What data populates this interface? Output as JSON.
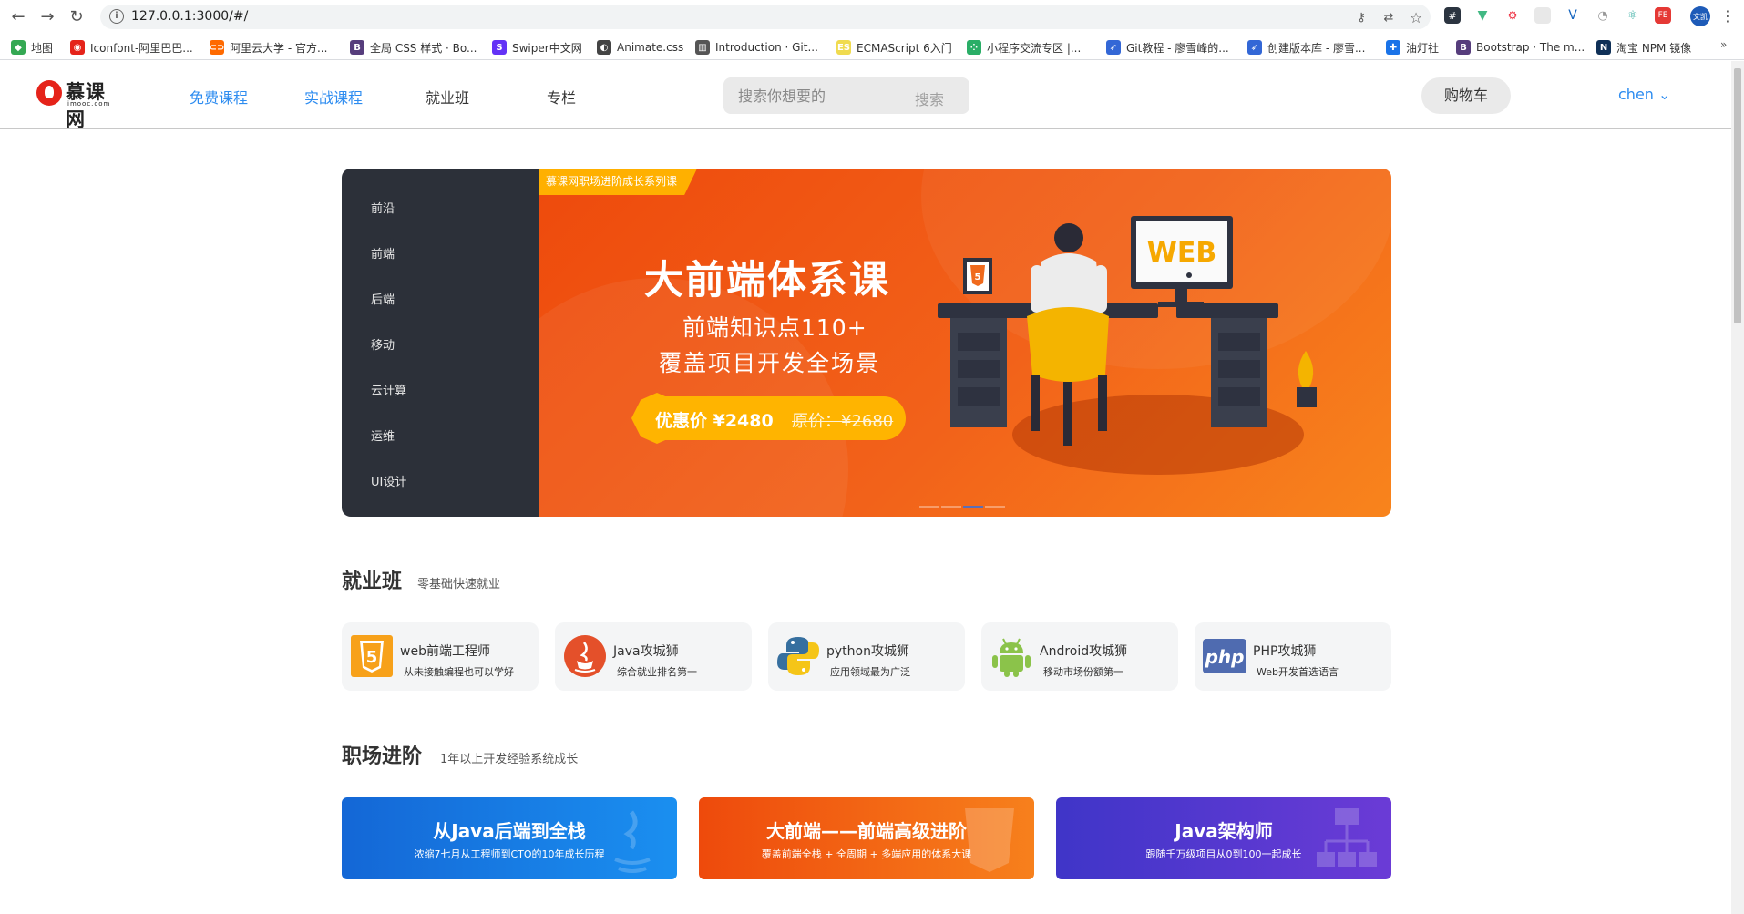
{
  "browser": {
    "url": "127.0.0.1:3000/#/",
    "profile_label": "文凯",
    "bookmarks": [
      {
        "label": "地图",
        "color": "#34a853",
        "glyph": "◆"
      },
      {
        "label": "Iconfont-阿里巴巴...",
        "color": "#e5231a",
        "glyph": "◉"
      },
      {
        "label": "阿里云大学 - 官方...",
        "color": "#ff6a00",
        "glyph": "⊂⊃"
      },
      {
        "label": "全局 CSS 样式 · Bo...",
        "color": "#563d7c",
        "glyph": "B"
      },
      {
        "label": "Swiper中文网",
        "color": "#6332f6",
        "glyph": "S"
      },
      {
        "label": "Animate.css",
        "color": "#444444",
        "glyph": "◐"
      },
      {
        "label": "Introduction · Git...",
        "color": "#555555",
        "glyph": "▥"
      },
      {
        "label": "ECMAScript 6入门",
        "color": "#f0db4f",
        "glyph": "ES"
      },
      {
        "label": "小程序交流专区 |...",
        "color": "#2aae67",
        "glyph": "⁘"
      },
      {
        "label": "Git教程 - 廖雪峰的...",
        "color": "#3367d6",
        "glyph": "➶"
      },
      {
        "label": "创建版本库 - 廖雪...",
        "color": "#3367d6",
        "glyph": "➶"
      },
      {
        "label": "油灯社",
        "color": "#1a73e8",
        "glyph": "✚"
      },
      {
        "label": "Bootstrap · The m...",
        "color": "#563d7c",
        "glyph": "B"
      },
      {
        "label": "淘宝 NPM 镜像",
        "color": "#0f3057",
        "glyph": "N"
      }
    ]
  },
  "header": {
    "logo_text": "慕课网",
    "logo_sub": "imooc.com",
    "nav": [
      "免费课程",
      "实战课程",
      "就业班",
      "专栏"
    ],
    "search_placeholder": "搜索你想要的",
    "search_button": "搜索",
    "cart": "购物车",
    "user": "chen ⌄"
  },
  "banner": {
    "categories": [
      "前沿",
      "前端",
      "后端",
      "移动",
      "云计算",
      "运维",
      "UI设计"
    ],
    "ribbon": "慕课网职场进阶成长系列课",
    "title": "大前端体系课",
    "subtitle_1": "前端知识点110+",
    "subtitle_2": "覆盖项目开发全场景",
    "price_now": "优惠价 ¥2480",
    "price_old": "原价：¥2680",
    "screen_text": "WEB",
    "slide_count": 4,
    "active_slide": 3
  },
  "employment": {
    "title": "就业班",
    "subtitle": "零基础快速就业",
    "cards": [
      {
        "name": "web前端工程师",
        "desc": "从未接触编程也可以学好",
        "icon": "html5-icon"
      },
      {
        "name": "Java攻城狮",
        "desc": "综合就业排名第一",
        "icon": "java-icon"
      },
      {
        "name": "python攻城狮",
        "desc": "应用领域最为广泛",
        "icon": "python-icon"
      },
      {
        "name": "Android攻城狮",
        "desc": "移动市场份额第一",
        "icon": "android-icon"
      },
      {
        "name": "PHP攻城狮",
        "desc": "Web开发首选语言",
        "icon": "php-icon"
      }
    ]
  },
  "advance": {
    "title": "职场进阶",
    "subtitle": "1年以上开发经验系统成长",
    "cards": [
      {
        "title": "从Java后端到全栈",
        "desc": "浓缩7七月从工程师到CTO的10年成长历程",
        "color_from": "#1467d6",
        "color_to": "#1a8ff0"
      },
      {
        "title": "大前端——前端高级进阶",
        "desc": "覆盖前端全栈 + 全周期 + 多端应用的体系大课",
        "color_from": "#ee4a0c",
        "color_to": "#f7801c"
      },
      {
        "title": "Java架构师",
        "desc": "跟随千万级项目从0到100一起成长",
        "color_from": "#3f35c8",
        "color_to": "#6b3bd6"
      }
    ]
  }
}
